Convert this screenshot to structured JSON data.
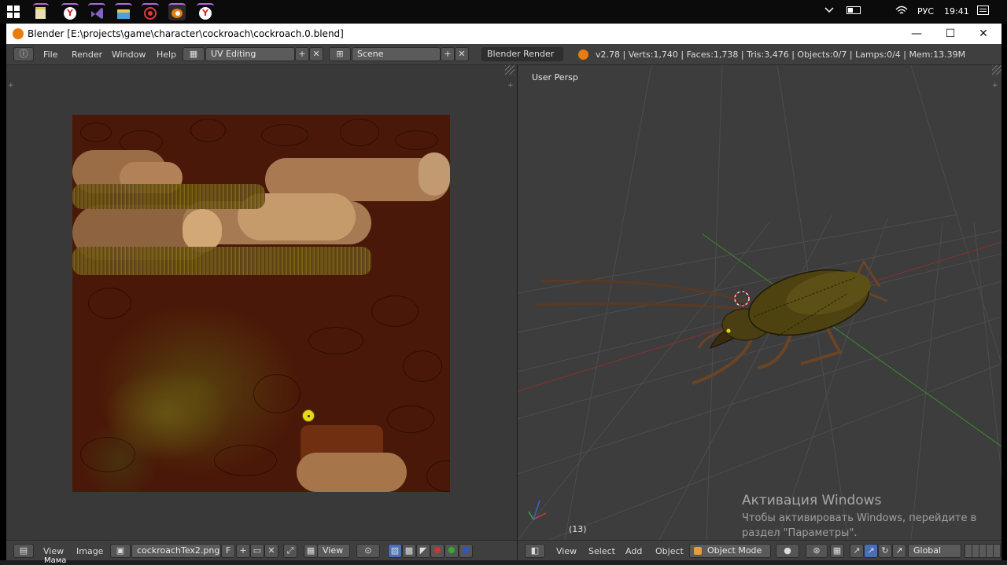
{
  "taskbar": {
    "apps": [
      {
        "name": "windows-start-icon",
        "color": "#ffffff"
      },
      {
        "name": "notepad-icon",
        "color": "#d9c64a"
      },
      {
        "name": "yandex-browser-icon",
        "color": "#ffffff"
      },
      {
        "name": "visual-studio-icon",
        "color": "#8661c5"
      },
      {
        "name": "file-explorer-icon",
        "color": "#f3c44a"
      },
      {
        "name": "media-player-icon",
        "color": "#e03a3a"
      },
      {
        "name": "blender-icon",
        "color": "#e87d0d"
      },
      {
        "name": "yandex-browser-icon",
        "color": "#ffffff"
      }
    ],
    "language": "РУС",
    "time": "19:41"
  },
  "window": {
    "title": "Blender [E:\\projects\\game\\character\\cockroach\\cockroach.0.blend]",
    "minimize": "—",
    "maximize": "☐",
    "close": "✕"
  },
  "header": {
    "menus": [
      "File",
      "Render",
      "Window",
      "Help"
    ],
    "layout": "UV Editing",
    "scene": "Scene",
    "engine": "Blender Render",
    "stats": "v2.78 | Verts:1,740 | Faces:1,738 | Tris:3,476 | Objects:0/7 | Lamps:0/4 | Mem:13.39M"
  },
  "viewport": {
    "view_label": "User Persp",
    "frame": "(13)",
    "colors": {
      "grid": "#555555",
      "x_axis": "#9a3030",
      "y_axis": "#3b8c2a",
      "body": "#4d4210",
      "leg": "#5a3a20"
    }
  },
  "uv_footer": {
    "menus": [
      "View",
      "Image"
    ],
    "image_name": "cockroachTex2.png",
    "f_label": "F",
    "view_dropdown": "View"
  },
  "vp_footer": {
    "menus": [
      "View",
      "Select",
      "Add",
      "Object"
    ],
    "mode": "Object Mode",
    "orientation": "Global"
  },
  "activation": {
    "title": "Активация Windows",
    "subtitle": "Чтобы активировать Windows, перейдите в раздел \"Параметры\"."
  },
  "bottom": {
    "contact": "Мама"
  }
}
